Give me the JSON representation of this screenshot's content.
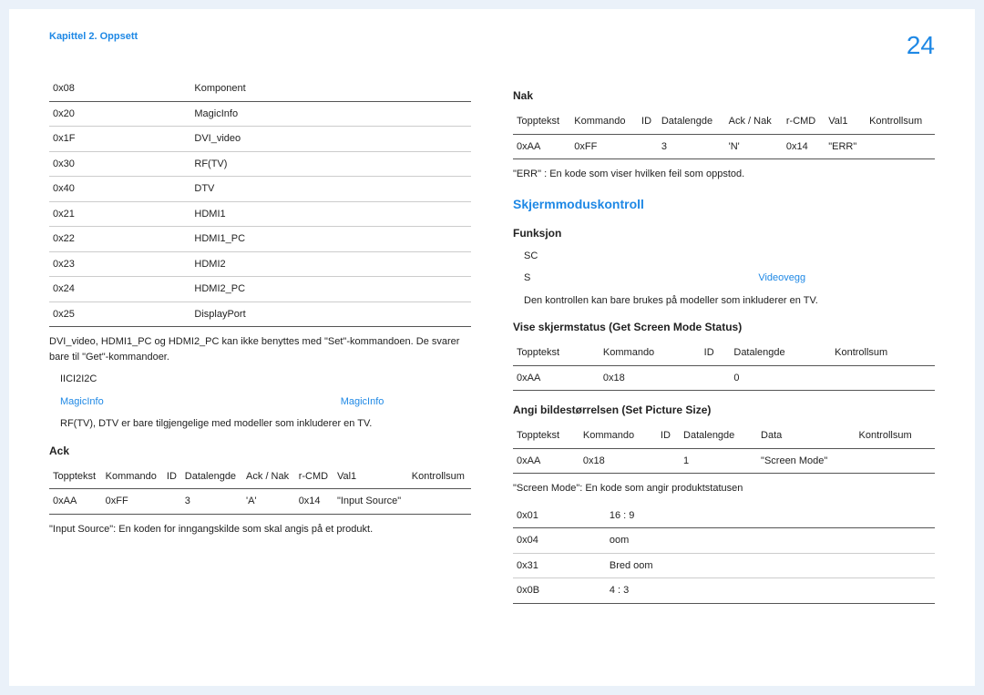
{
  "header": {
    "chapter": "Kapittel 2. Oppsett",
    "page": "24"
  },
  "left": {
    "codes": [
      [
        "0x08",
        "Komponent"
      ],
      [
        "0x20",
        "MagicInfo"
      ],
      [
        "0x1F",
        "DVI_video"
      ],
      [
        "0x30",
        "RF(TV)"
      ],
      [
        "0x40",
        "DTV"
      ],
      [
        "0x21",
        "HDMI1"
      ],
      [
        "0x22",
        "HDMI1_PC"
      ],
      [
        "0x23",
        "HDMI2"
      ],
      [
        "0x24",
        "HDMI2_PC"
      ],
      [
        "0x25",
        "DisplayPort"
      ]
    ],
    "note1": "DVI_video, HDMI1_PC og HDMI2_PC kan ikke benyttes med \"Set\"-kommandoen. De svarer bare til \"Get\"-kommandoer.",
    "bullet1": "IICI2I2C",
    "bullet2a": "MagicInfo",
    "bullet2b": "MagicInfo",
    "bullet3": "RF(TV), DTV er bare tilgjengelige med modeller som inkluderer en TV.",
    "ack": "Ack",
    "ackhdr": [
      "Topptekst",
      "Kommando",
      "ID",
      "Datalengde",
      "Ack / Nak",
      "r-CMD",
      "Val1",
      "Kontrollsum"
    ],
    "ackrow": [
      "0xAA",
      "0xFF",
      "",
      "3",
      "'A'",
      "0x14",
      "\"Input Source\"",
      ""
    ],
    "note2": "\"Input Source\": En koden for inngangskilde som skal angis på et produkt."
  },
  "right": {
    "nak": "Nak",
    "nakhdr": [
      "Topptekst",
      "Kommando",
      "ID",
      "Datalengde",
      "Ack / Nak",
      "r-CMD",
      "Val1",
      "Kontrollsum"
    ],
    "nakrow": [
      "0xAA",
      "0xFF",
      "",
      "3",
      "'N'",
      "0x14",
      "\"ERR\"",
      ""
    ],
    "errnote": "\"ERR\" : En kode som viser hvilken feil som oppstod.",
    "sec": "Skjermmoduskontroll",
    "funk": "Funksjon",
    "sc": "SC",
    "s": "S",
    "vid": "Videovegg",
    "funknote": "Den kontrollen kan bare brukes på modeller som inkluderer en TV.",
    "vise": "Vise skjermstatus (Get Screen Mode Status)",
    "visehdr": [
      "Topptekst",
      "Kommando",
      "ID",
      "Datalengde",
      "Kontrollsum"
    ],
    "viserow": [
      "0xAA",
      "0x18",
      "",
      "0",
      ""
    ],
    "angi": "Angi bildestørrelsen (Set Picture Size)",
    "angihdr": [
      "Topptekst",
      "Kommando",
      "ID",
      "Datalengde",
      "Data",
      "Kontrollsum"
    ],
    "angirow": [
      "0xAA",
      "0x18",
      "",
      "1",
      "\"Screen Mode\"",
      ""
    ],
    "smnote": "\"Screen Mode\": En kode som angir produktstatusen",
    "modes": [
      [
        "0x01",
        "16 : 9"
      ],
      [
        "0x04",
        "oom"
      ],
      [
        "0x31",
        "Bred oom"
      ],
      [
        "0x0B",
        "4 : 3"
      ]
    ]
  }
}
